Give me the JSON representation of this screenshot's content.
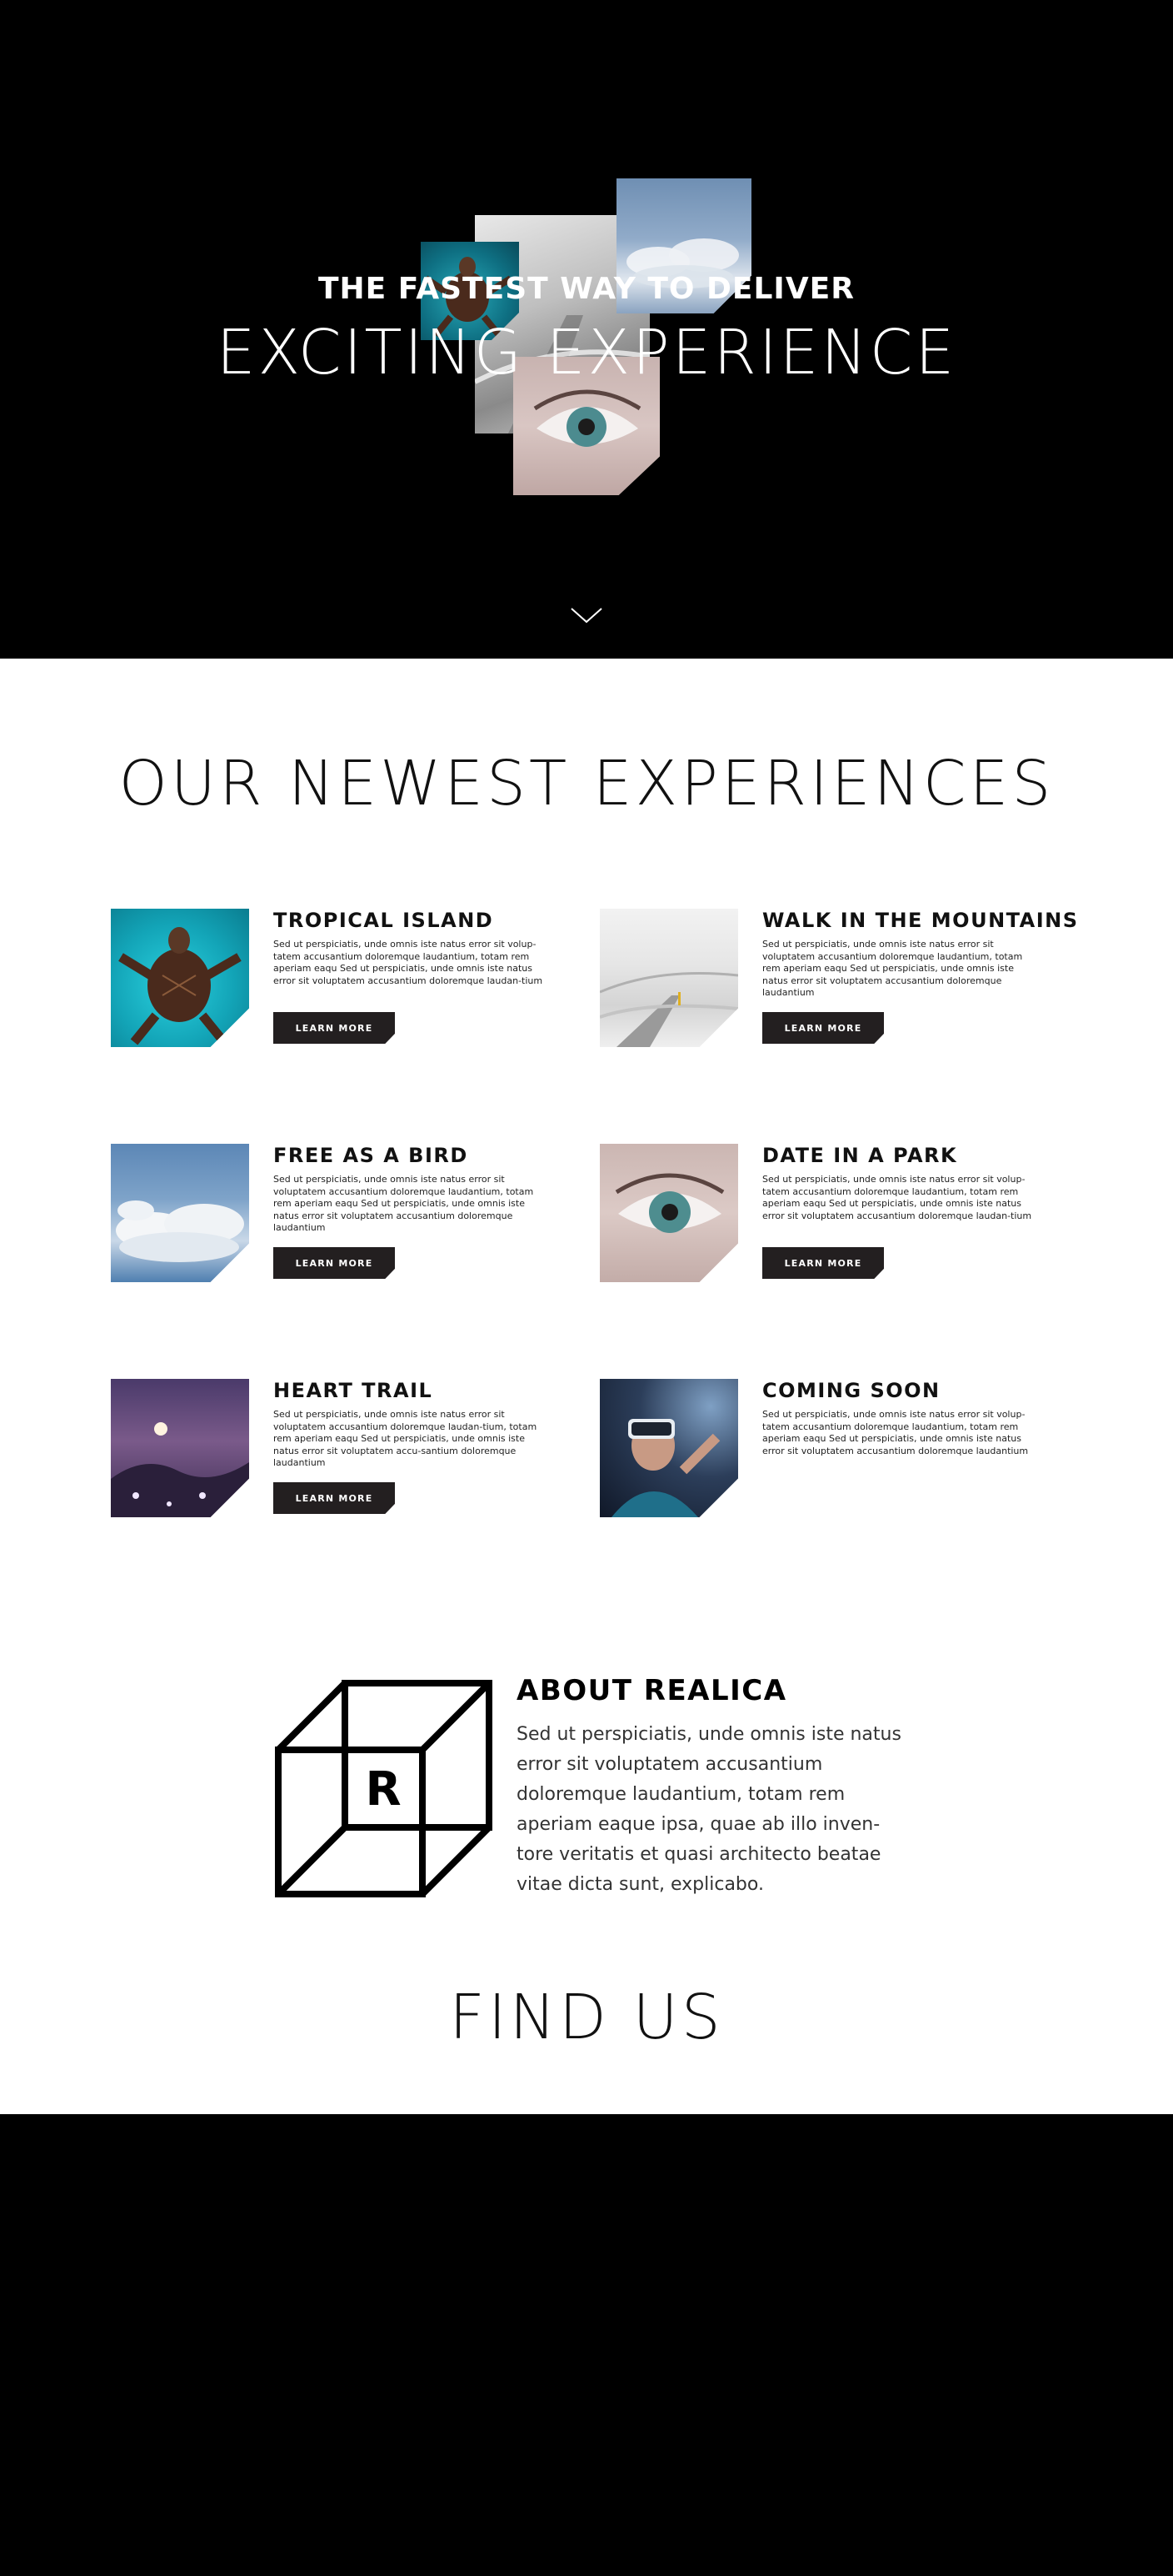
{
  "hero": {
    "line1": "THE FASTEST WAY TO DELIVER",
    "line2": "EXCITING EXPERIENCE",
    "scroll_icon": "chevron-down-icon"
  },
  "newest": {
    "title": "OUR NEWEST EXPERIENCES",
    "cards": [
      {
        "title": "TROPICAL ISLAND",
        "text": "Sed ut perspiciatis, unde omnis iste natus error sit volup-tatem accusantium doloremque laudantium, totam rem aperiam eaqu Sed ut perspiciatis, unde omnis iste natus error sit voluptatem accusantium doloremque laudan-tium",
        "button": "LEARN MORE",
        "image": "sea-turtle-image"
      },
      {
        "title": "WALK IN THE MOUNTAINS",
        "text": "Sed ut perspiciatis, unde omnis iste natus error sit voluptatem accusantium doloremque laudantium, totam rem aperiam eaqu Sed ut perspiciatis, unde omnis iste natus error sit voluptatem accusantium doloremque laudantium",
        "button": "LEARN MORE",
        "image": "snowy-road-image"
      },
      {
        "title": "FREE AS A BIRD",
        "text": "Sed ut perspiciatis, unde omnis iste natus error sit voluptatem accusantium doloremque laudantium, totam rem aperiam eaqu Sed ut perspiciatis, unde omnis iste natus error sit voluptatem accusantium doloremque laudantium",
        "button": "LEARN MORE",
        "image": "clouds-image"
      },
      {
        "title": "DATE IN A PARK",
        "text": "Sed ut perspiciatis, unde omnis iste natus error sit volup-tatem accusantium doloremque laudantium, totam rem aperiam eaqu Sed ut perspiciatis, unde omnis iste natus error sit voluptatem accusantium doloremque laudan-tium",
        "button": "LEARN MORE",
        "image": "eye-image"
      },
      {
        "title": "HEART TRAIL",
        "text": "Sed ut perspiciatis, unde omnis iste natus error sit voluptatem accusantium doloremque laudan-tium, totam rem aperiam eaqu Sed ut perspiciatis, unde omnis iste natus error sit voluptatem accu-santium doloremque laudantium",
        "button": "LEARN MORE",
        "image": "moonlit-hills-image"
      },
      {
        "title": "COMING SOON",
        "text": "Sed ut perspiciatis, unde omnis iste natus error sit volup-tatem accusantium doloremque laudantium, totam rem aperiam eaqu Sed ut perspiciatis, unde omnis iste natus error sit voluptatem accusantium doloremque laudantium",
        "button": "",
        "image": "vr-headset-image"
      }
    ]
  },
  "about": {
    "title": "ABOUT REALICA",
    "text": "Sed ut perspiciatis, unde omnis iste natus error sit voluptatem accusantium doloremque laudantium, totam rem aperiam eaque ipsa, quae ab illo inven-tore veritatis et quasi architecto beatae vitae dicta sunt, explicabo.",
    "logo_letter": "R",
    "logo_icon": "cube-logo-icon"
  },
  "find_us": {
    "title": "FIND US"
  },
  "colors": {
    "hero_bg": "#000000",
    "button_bg": "#231f20",
    "footer_bg": "#000000"
  }
}
